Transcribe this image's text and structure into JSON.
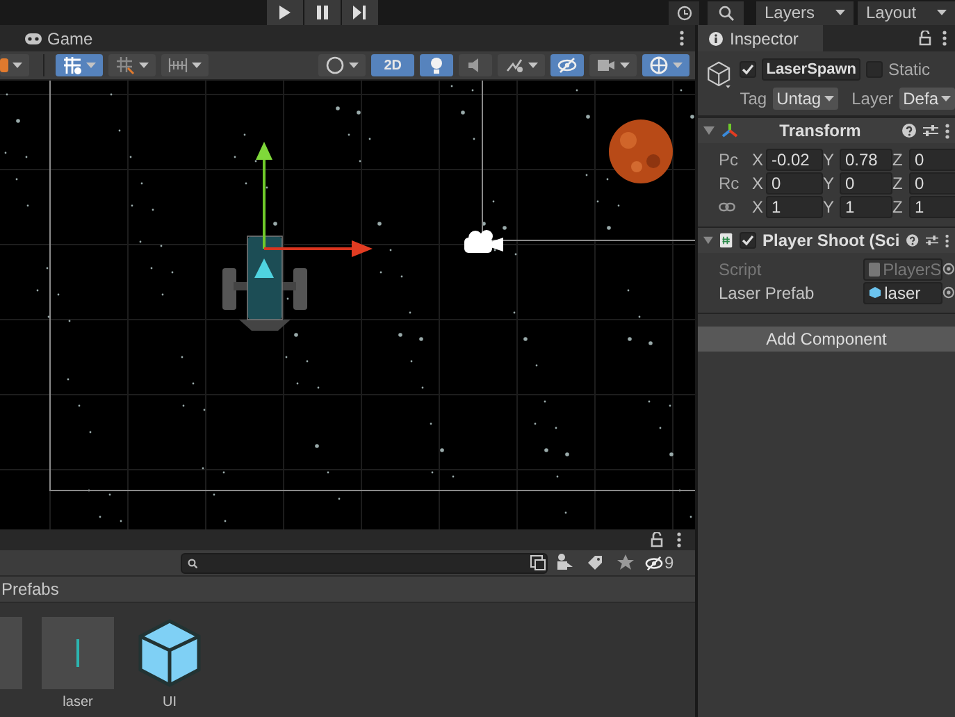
{
  "toolbar": {
    "layers": "Layers",
    "layout": "Layout"
  },
  "scene_panel": {
    "tabs": [
      {
        "label": "Game",
        "selected": false
      }
    ],
    "toolbar_left": [
      {
        "kind": "tool-handle",
        "on": false,
        "dropdown": true
      },
      {
        "kind": "grid-snap",
        "on": true,
        "dropdown": true
      },
      {
        "kind": "grid",
        "on": false,
        "dropdown": true
      },
      {
        "kind": "increment-snap",
        "on": false,
        "dropdown": true
      }
    ],
    "toolbar_right": [
      {
        "kind": "shading",
        "on": false,
        "dropdown": true
      },
      {
        "kind": "mode",
        "label": "2D",
        "on": true,
        "dropdown": false
      },
      {
        "kind": "lighting",
        "on": true,
        "dropdown": false
      },
      {
        "kind": "audio",
        "on": false,
        "dropdown": false
      },
      {
        "kind": "effects",
        "on": false,
        "dropdown": true
      },
      {
        "kind": "visibility",
        "on": true,
        "dropdown": false
      },
      {
        "kind": "camera",
        "on": false,
        "dropdown": true
      },
      {
        "kind": "gizmos",
        "on": true,
        "dropdown": true
      }
    ]
  },
  "project": {
    "hidden_count": "9",
    "breadcrumb": "Prefabs",
    "assets": [
      {
        "kind": "partial"
      },
      {
        "kind": "sprite",
        "name": "laser"
      },
      {
        "kind": "prefab",
        "name": "UI"
      }
    ]
  },
  "inspector": {
    "tab": "Inspector",
    "object": {
      "active": true,
      "name": "LaserSpawn",
      "static": false,
      "static_label": "Static",
      "tag_label": "Tag",
      "tag": "Untag",
      "layer_label": "Layer",
      "layer": "Defa"
    },
    "components": [
      {
        "kind": "transform",
        "title": "Transform",
        "expanded": true,
        "rows": [
          {
            "kind": "position",
            "label": "Pc",
            "fields": [
              {
                "axis": "X",
                "value": "-0.02"
              },
              {
                "axis": "Y",
                "value": "0.78"
              },
              {
                "axis": "Z",
                "value": "0"
              }
            ]
          },
          {
            "kind": "rotation",
            "label": "Rc",
            "fields": [
              {
                "axis": "X",
                "value": "0"
              },
              {
                "axis": "Y",
                "value": "0"
              },
              {
                "axis": "Z",
                "value": "0"
              }
            ]
          },
          {
            "kind": "scale",
            "fields": [
              {
                "axis": "X",
                "value": "1"
              },
              {
                "axis": "Y",
                "value": "1"
              },
              {
                "axis": "Z",
                "value": "1"
              }
            ]
          }
        ]
      },
      {
        "kind": "script",
        "title": "Player Shoot (Sci",
        "expanded": true,
        "enabled": true,
        "properties": [
          {
            "kind": "script",
            "label": "Script",
            "value": "PlayerS",
            "disabled": true
          },
          {
            "kind": "prefab",
            "label": "Laser Prefab",
            "value": "laser",
            "disabled": false
          }
        ]
      }
    ],
    "add_component": "Add Component"
  }
}
